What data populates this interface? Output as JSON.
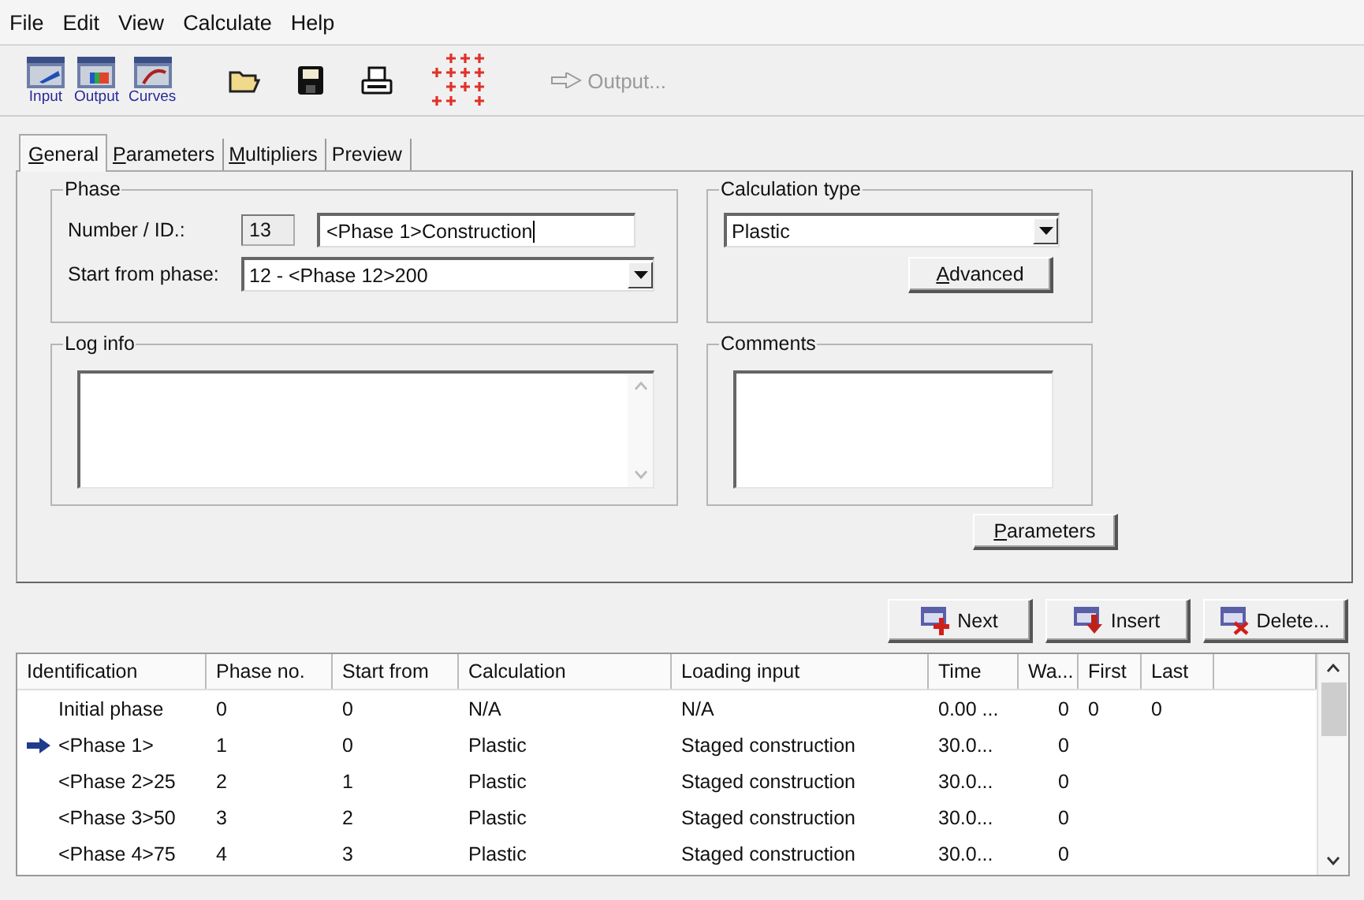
{
  "menu": [
    {
      "label": "File"
    },
    {
      "label": "Edit"
    },
    {
      "label": "View"
    },
    {
      "label": "Calculate"
    },
    {
      "label": "Help"
    }
  ],
  "toolbar": [
    {
      "kind": "big",
      "label": "Input"
    },
    {
      "kind": "big",
      "label": "Output"
    },
    {
      "kind": "big",
      "label": "Curves"
    },
    {
      "kind": "icon"
    },
    {
      "kind": "icon"
    },
    {
      "kind": "icon"
    },
    {
      "kind": "icon"
    },
    {
      "kind": "text",
      "label": "Output...",
      "disabled": true
    }
  ],
  "tabs": [
    {
      "label": "General",
      "mnemonic": true,
      "selected": true
    },
    {
      "label": "Parameters",
      "mnemonic": true,
      "selected": false
    },
    {
      "label": "Multipliers",
      "mnemonic": true,
      "selected": false
    },
    {
      "label": "Preview",
      "mnemonic": false,
      "selected": false
    }
  ],
  "phase": {
    "title": "Phase",
    "number_label": "Number / ID.:",
    "number": "13",
    "id": "<Phase 1>Construction",
    "start_label": "Start from phase:",
    "start": "12 - <Phase 12>200"
  },
  "calculation_type": {
    "title": "Calculation type",
    "value": "Plastic",
    "advanced": {
      "label": "Advanced",
      "mnemonic": true
    }
  },
  "log_info": {
    "title": "Log info"
  },
  "comments": {
    "title": "Comments"
  },
  "parameters_button": {
    "label": "Parameters",
    "mnemonic": true
  },
  "actions": [
    {
      "label": "Next"
    },
    {
      "label": "Insert"
    },
    {
      "label": "Delete..."
    }
  ],
  "table": {
    "columns": [
      "Identification",
      "Phase no.",
      "Start from",
      "Calculation",
      "Loading input",
      "Time",
      "Wa...",
      "First",
      "Last"
    ],
    "rows": [
      {
        "current": false,
        "cells": [
          "Initial phase",
          "0",
          "0",
          "N/A",
          "N/A",
          "0.00 ...",
          "0",
          "0",
          "0"
        ]
      },
      {
        "current": true,
        "cells": [
          "<Phase 1>",
          "1",
          "0",
          "Plastic",
          "Staged construction",
          "30.0...",
          "0",
          "",
          ""
        ]
      },
      {
        "current": false,
        "cells": [
          "<Phase 2>25",
          "2",
          "1",
          "Plastic",
          "Staged construction",
          "30.0...",
          "0",
          "",
          ""
        ]
      },
      {
        "current": false,
        "cells": [
          "<Phase 3>50",
          "3",
          "2",
          "Plastic",
          "Staged construction",
          "30.0...",
          "0",
          "",
          ""
        ]
      },
      {
        "current": false,
        "cells": [
          "<Phase 4>75",
          "4",
          "3",
          "Plastic",
          "Staged construction",
          "30.0...",
          "0",
          "",
          ""
        ]
      }
    ]
  }
}
